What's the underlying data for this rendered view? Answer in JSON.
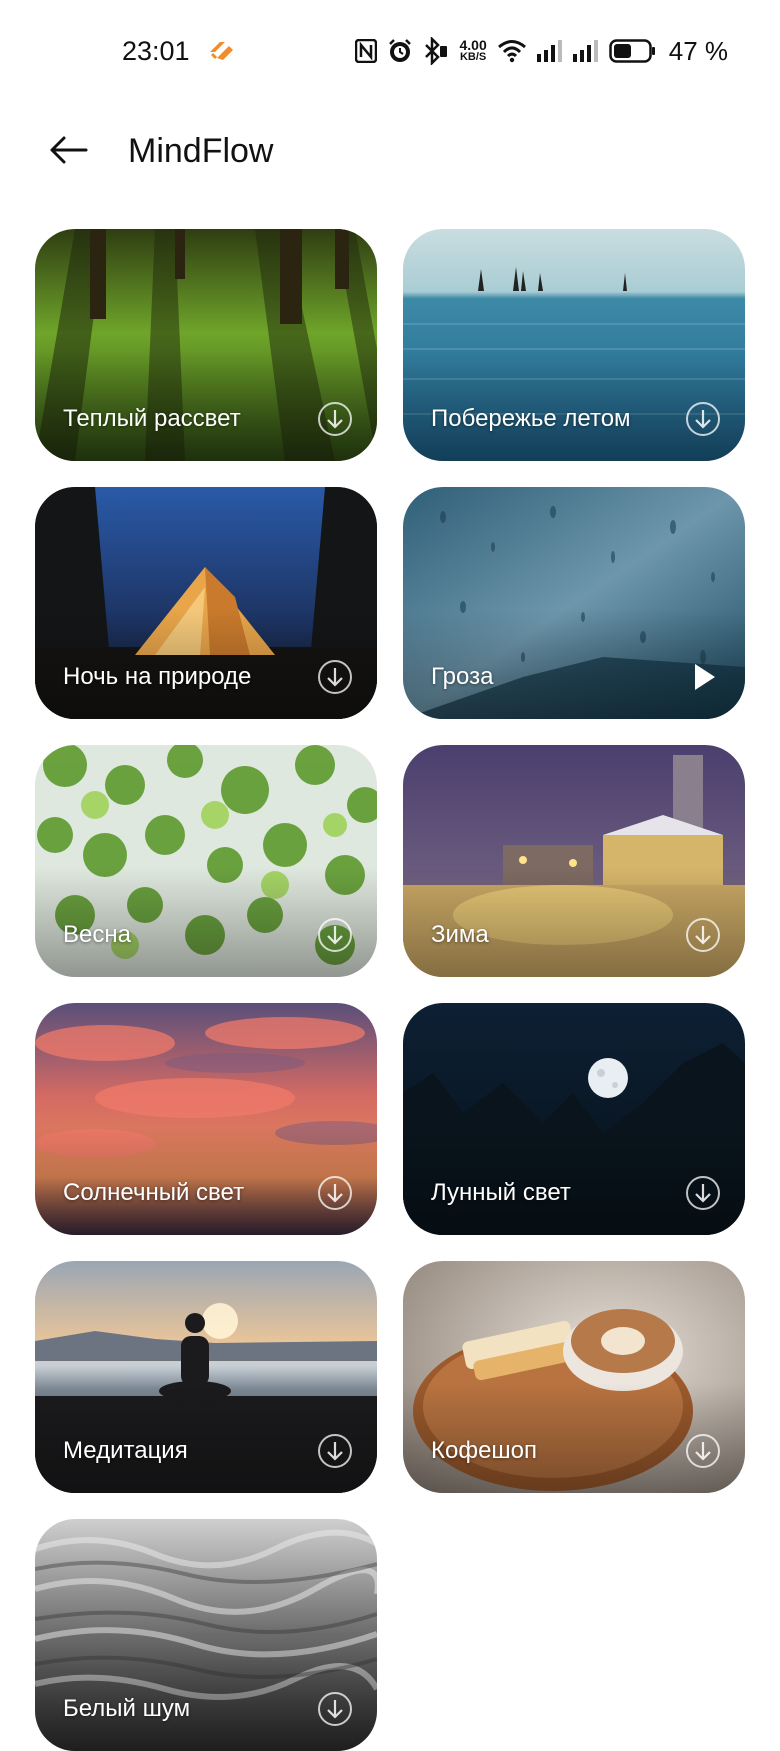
{
  "status_bar": {
    "time": "23:01",
    "net_speed_value": "4.00",
    "net_speed_unit": "KB/S",
    "battery_percent": "47 %",
    "icons": [
      "nfc-icon",
      "alarm-icon",
      "bluetooth-icon",
      "wifi-icon",
      "signal-icon",
      "signal-icon",
      "battery-icon"
    ]
  },
  "header": {
    "title": "MindFlow",
    "back_icon": "arrow-left-icon"
  },
  "sounds": [
    {
      "label": "Теплый рассвет",
      "action": "download"
    },
    {
      "label": "Побережье летом",
      "action": "download"
    },
    {
      "label": "Ночь на природе",
      "action": "download"
    },
    {
      "label": "Гроза",
      "action": "play"
    },
    {
      "label": "Весна",
      "action": "download"
    },
    {
      "label": "Зима",
      "action": "download"
    },
    {
      "label": "Солнечный свет",
      "action": "download"
    },
    {
      "label": "Лунный свет",
      "action": "download"
    },
    {
      "label": "Медитация",
      "action": "download"
    },
    {
      "label": "Кофешоп",
      "action": "download"
    },
    {
      "label": "Белый шум",
      "action": "download"
    }
  ],
  "colors": {
    "brand_accent": "#f28c28",
    "text_primary": "#111111",
    "label_text": "#ffffff"
  }
}
